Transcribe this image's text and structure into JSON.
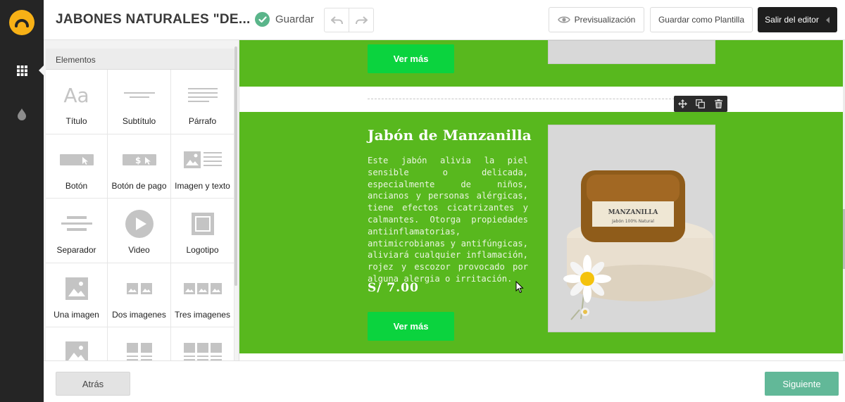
{
  "topbar": {
    "title": "JABONES NATURALES \"DE...",
    "save_label": "Guardar",
    "preview_label": "Previsualización",
    "save_template_label": "Guardar como Plantilla",
    "exit_label": "Salir del editor"
  },
  "rail": {
    "items": [
      {
        "icon": "grid-icon",
        "active": true
      },
      {
        "icon": "drop-icon",
        "active": false
      }
    ]
  },
  "panel": {
    "header": "Elementos",
    "items": [
      {
        "label": "Título",
        "icon": "title-icon"
      },
      {
        "label": "Subtítulo",
        "icon": "subtitle-icon"
      },
      {
        "label": "Párrafo",
        "icon": "paragraph-icon"
      },
      {
        "label": "Botón",
        "icon": "button-icon"
      },
      {
        "label": "Botón de pago",
        "icon": "pay-button-icon"
      },
      {
        "label": "Imagen y texto",
        "icon": "image-text-icon"
      },
      {
        "label": "Separador",
        "icon": "separator-icon"
      },
      {
        "label": "Video",
        "icon": "video-icon"
      },
      {
        "label": "Logotipo",
        "icon": "logo-icon"
      },
      {
        "label": "Una imagen",
        "icon": "one-image-icon"
      },
      {
        "label": "Dos imagenes",
        "icon": "two-images-icon"
      },
      {
        "label": "Tres imagenes",
        "icon": "three-images-icon"
      }
    ]
  },
  "canvas": {
    "top_section": {
      "button_label": "Ver más"
    },
    "product": {
      "title": "Jabón de Manzanilla",
      "description": "Este jabón alivia la piel sensible o delicada, especialmente de niños, ancianos y personas alérgicas, tiene efectos cicatrizantes y calmantes. Otorga propiedades antiinflamatorias, antimicrobianas y antifúngicas, aliviará cualquier inflamación, rojez y escozor provocado por alguna alergia o irritación.",
      "price": "S/ 7.00",
      "button_label": "Ver más",
      "image_label_line1": "MANZANILLA",
      "image_label_line2": "Jabón 100% Natural"
    },
    "colors": {
      "section_bg": "#58b81e",
      "button_bg": "#0bd33e"
    }
  },
  "footer": {
    "back_label": "Atrás",
    "next_label": "Siguiente"
  },
  "colors": {
    "rail_bg": "#252525",
    "logo": "#f7b116",
    "accent_next": "#62b898",
    "check": "#5ab58a"
  }
}
